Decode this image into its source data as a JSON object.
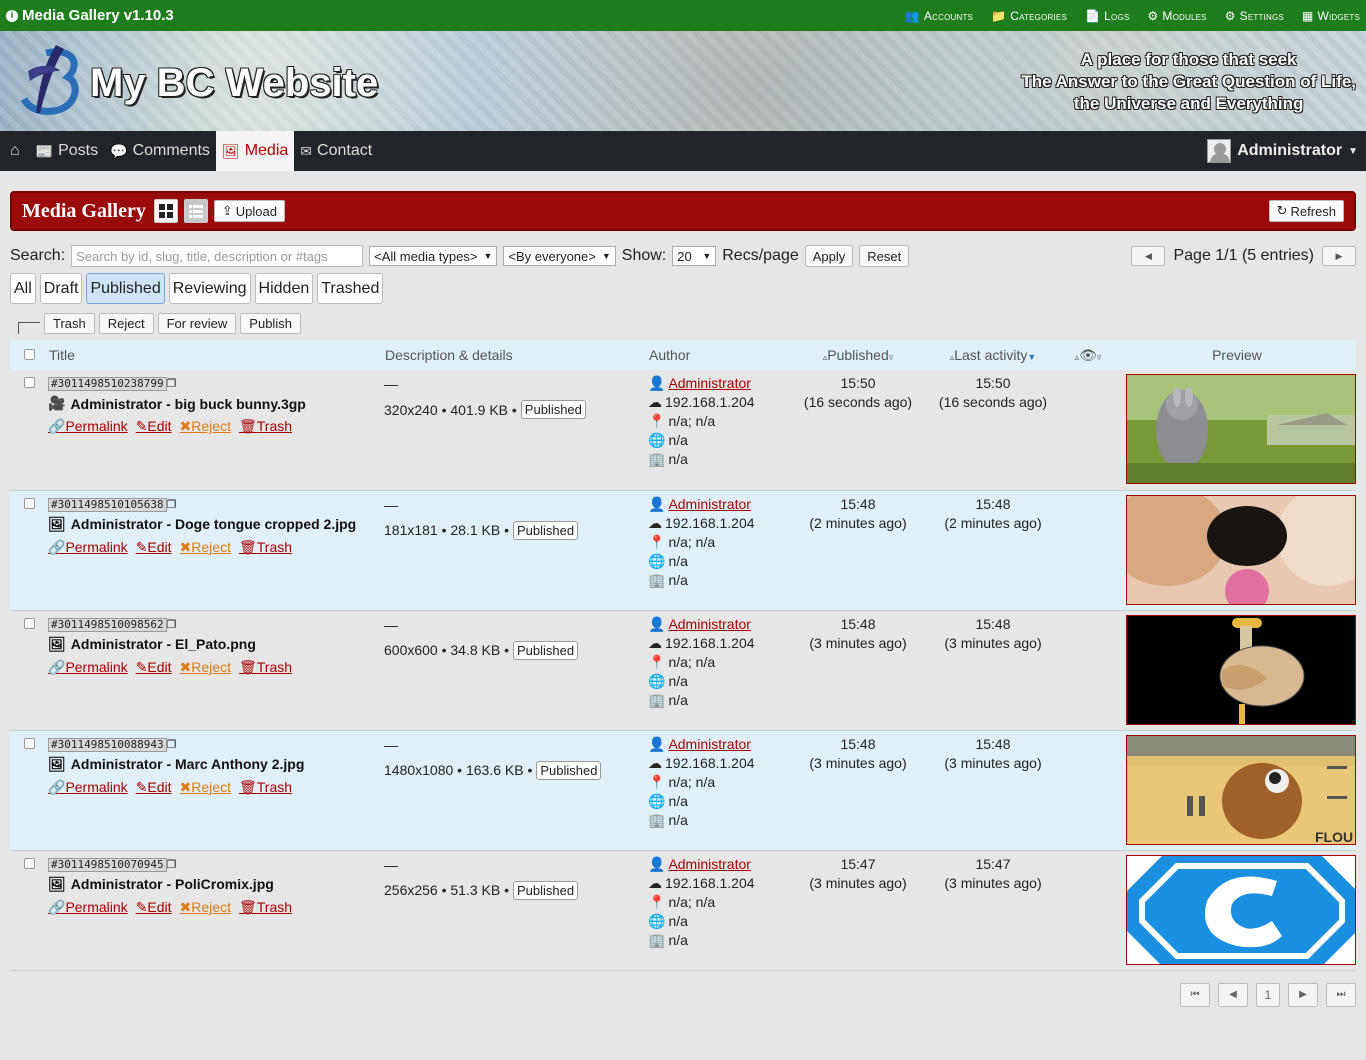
{
  "topbar": {
    "app_title": "Media Gallery v1.10.3",
    "nav": [
      {
        "label": "Accounts",
        "icon": "users-icon",
        "glyph": "👥"
      },
      {
        "label": "Categories",
        "icon": "folder-icon",
        "glyph": "📁"
      },
      {
        "label": "Logs",
        "icon": "document-icon",
        "glyph": "📄"
      },
      {
        "label": "Modules",
        "icon": "puzzle-icon",
        "glyph": "⚙"
      },
      {
        "label": "Settings",
        "icon": "cogs-icon",
        "glyph": "⚙"
      },
      {
        "label": "Widgets",
        "icon": "cubes-icon",
        "glyph": "▦"
      }
    ]
  },
  "banner": {
    "site_name": "My BC Website",
    "tagline_1": "A place for those that seek",
    "tagline_2": "The Answer to the Great Question of Life,",
    "tagline_3": "the Universe and Everything"
  },
  "mainnav": {
    "items": [
      {
        "label": "Posts",
        "icon": "newspaper-icon",
        "active": false
      },
      {
        "label": "Comments",
        "icon": "comments-icon",
        "active": false
      },
      {
        "label": "Media",
        "icon": "image-icon",
        "active": true
      },
      {
        "label": "Contact",
        "icon": "envelope-icon",
        "active": false
      }
    ],
    "user": "Administrator"
  },
  "gallery": {
    "title": "Media Gallery",
    "upload": "Upload",
    "refresh": "Refresh"
  },
  "search": {
    "label": "Search:",
    "placeholder": "Search by id, slug, title, description or #tags",
    "type_select": "<All media types>",
    "owner_select": "<By everyone>",
    "show_label": "Show:",
    "show_value": "20",
    "per_page_label": "Recs/page",
    "apply": "Apply",
    "reset": "Reset",
    "page_info": "Page 1/1 (5 entries)"
  },
  "filters": [
    "All",
    "Draft",
    "Published",
    "Reviewing",
    "Hidden",
    "Trashed"
  ],
  "filters_active": "Published",
  "bulk": [
    "Trash",
    "Reject",
    "For review",
    "Publish"
  ],
  "table": {
    "headers": {
      "title": "Title",
      "desc": "Description & details",
      "author": "Author",
      "published": "Published",
      "last_activity": "Last activity",
      "preview": "Preview"
    },
    "action_labels": {
      "permalink": "Permalink",
      "edit": "Edit",
      "reject": "Reject",
      "trash": "Trash"
    },
    "rows": [
      {
        "id": "#3011498510238799",
        "type": "video",
        "title": "Administrator - big buck bunny.3gp",
        "dash": "—",
        "details": "320x240 • 401.9 KB •",
        "status": "Published",
        "author": "Administrator",
        "ip": "192.168.1.204",
        "location": "n/a; n/a",
        "country": "n/a",
        "device": "n/a",
        "pub_time": "15:50",
        "pub_ago": "(16 seconds ago)",
        "act_time": "15:50",
        "act_ago": "(16 seconds ago)",
        "preview": "bunny"
      },
      {
        "id": "#3011498510105638",
        "type": "image",
        "title": "Administrator - Doge tongue cropped 2.jpg",
        "dash": "—",
        "details": "181x181 • 28.1 KB •",
        "status": "Published",
        "author": "Administrator",
        "ip": "192.168.1.204",
        "location": "n/a; n/a",
        "country": "n/a",
        "device": "n/a",
        "pub_time": "15:48",
        "pub_ago": "(2 minutes ago)",
        "act_time": "15:48",
        "act_ago": "(2 minutes ago)",
        "preview": "doge"
      },
      {
        "id": "#3011498510098562",
        "type": "image",
        "title": "Administrator - El_Pato.png",
        "dash": "—",
        "details": "600x600 • 34.8 KB •",
        "status": "Published",
        "author": "Administrator",
        "ip": "192.168.1.204",
        "location": "n/a; n/a",
        "country": "n/a",
        "device": "n/a",
        "pub_time": "15:48",
        "pub_ago": "(3 minutes ago)",
        "act_time": "15:48",
        "act_ago": "(3 minutes ago)",
        "preview": "pato"
      },
      {
        "id": "#3011498510088943",
        "type": "image",
        "title": "Administrator - Marc Anthony 2.jpg",
        "dash": "—",
        "details": "1480x1080 • 163.6 KB •",
        "status": "Published",
        "author": "Administrator",
        "ip": "192.168.1.204",
        "location": "n/a; n/a",
        "country": "n/a",
        "device": "n/a",
        "pub_time": "15:48",
        "pub_ago": "(3 minutes ago)",
        "act_time": "15:48",
        "act_ago": "(3 minutes ago)",
        "preview": "marc",
        "preview_text": "FLOU"
      },
      {
        "id": "#3011498510070945",
        "type": "image",
        "title": "Administrator - PoliCromix.jpg",
        "dash": "—",
        "details": "256x256 • 51.3 KB •",
        "status": "Published",
        "author": "Administrator",
        "ip": "192.168.1.204",
        "location": "n/a; n/a",
        "country": "n/a",
        "device": "n/a",
        "pub_time": "15:47",
        "pub_ago": "(3 minutes ago)",
        "act_time": "15:47",
        "act_ago": "(3 minutes ago)",
        "preview": "policromix"
      }
    ]
  },
  "footer_pager": {
    "current": "1"
  }
}
